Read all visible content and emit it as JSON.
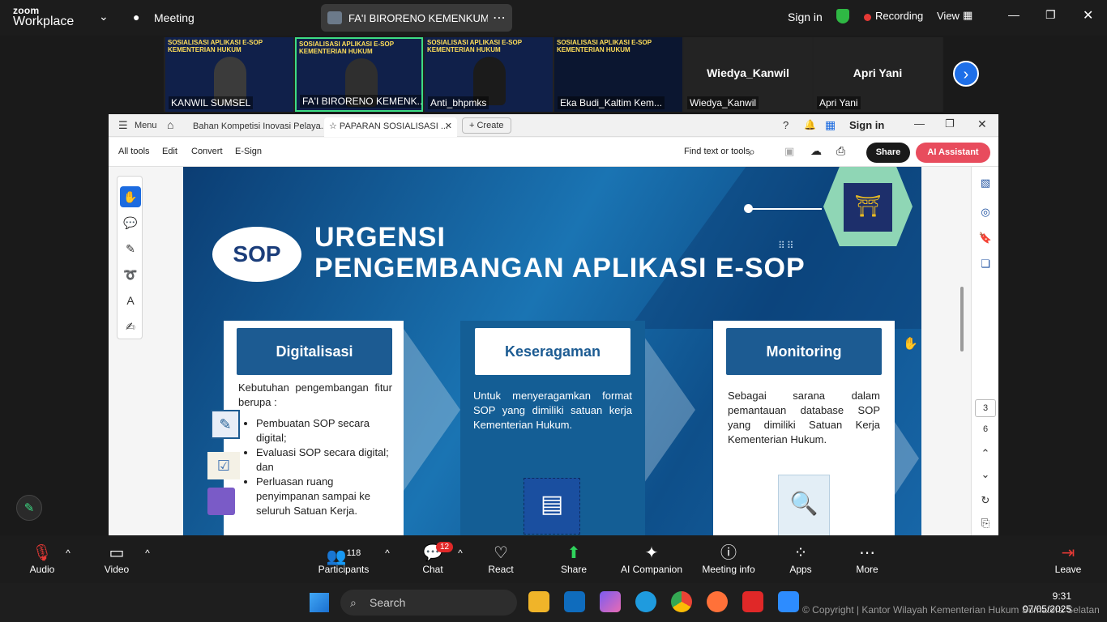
{
  "topbar": {
    "brand_small": "zoom",
    "brand_big": "Workplace",
    "meeting_label": "Meeting",
    "share_title": "FA'I BIRORENO KEMENKUM's scr",
    "sign_in": "Sign in",
    "recording": "Recording",
    "view": "View"
  },
  "participants": [
    {
      "name": "KANWIL SUMSEL",
      "banner": "SOSIALISASI APLIKASI E-SOP KEMENTERIAN HUKUM"
    },
    {
      "name": "FA'I BIRORENO KEMENK...",
      "banner": "SOSIALISASI APLIKASI E-SOP KEMENTERIAN HUKUM"
    },
    {
      "name": "Anti_bhpmks",
      "banner": "SOSIALISASI APLIKASI E-SOP KEMENTERIAN HUKUM"
    },
    {
      "name": "Eka Budi_Kaltim Kem...",
      "banner": "SOSIALISASI APLIKASI E-SOP KEMENTERIAN HUKUM"
    },
    {
      "name": "Wiedya_Kanwil",
      "big": "Wiedya_Kanwil"
    },
    {
      "name": "Apri Yani",
      "big": "Apri Yani"
    }
  ],
  "acrobat": {
    "menu": "Menu",
    "tab1": "Bahan Kompetisi Inovasi Pelaya...",
    "tab2": "PAPARAN SOSIALISASI ...",
    "create": "Create",
    "sign_in": "Sign in",
    "tools": [
      "All tools",
      "Edit",
      "Convert",
      "E-Sign"
    ],
    "find": "Find text or tools",
    "share": "Share",
    "ai": "AI Assistant",
    "page_current": "3",
    "page_total": "6"
  },
  "slide": {
    "logo": "SOP",
    "title_line1": "URGENSI",
    "title_line2": "PENGEMBANGAN APLIKASI E-SOP",
    "card1": {
      "head": "Digitalisasi",
      "intro": "Kebutuhan pengembangan fitur berupa :",
      "bullets": [
        "Pembuatan SOP secara digital;",
        "Evaluasi SOP secara digital; dan",
        "Perluasan ruang penyimpanan sampai ke seluruh Satuan Kerja."
      ]
    },
    "card2": {
      "head": "Keseragaman",
      "text": "Untuk menyeragamkan format SOP yang dimiliki satuan kerja Kementerian Hukum."
    },
    "card3": {
      "head": "Monitoring",
      "text": "Sebagai sarana dalam pemantauan database SOP yang dimiliki Satuan Kerja Kementerian Hukum."
    }
  },
  "bottombar": {
    "audio": "Audio",
    "video": "Video",
    "participants": "Participants",
    "participants_count": "118",
    "chat": "Chat",
    "chat_badge": "12",
    "react": "React",
    "share": "Share",
    "ai_companion": "AI Companion",
    "meeting_info": "Meeting info",
    "apps": "Apps",
    "more": "More",
    "leave": "Leave"
  },
  "taskbar": {
    "search": "Search",
    "watermark": "© Copyright | Kantor Wilayah Kementerian Hukum Sumatera Selatan",
    "time": "9:31",
    "date": "07/05/2025"
  }
}
